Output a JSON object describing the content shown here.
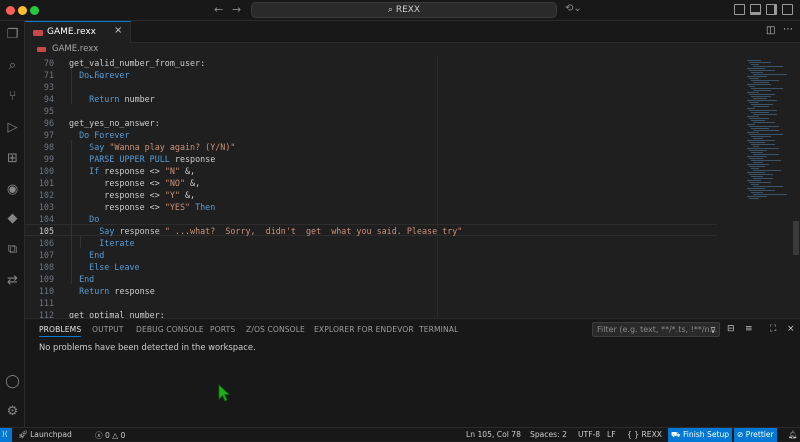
{
  "titlebar": {
    "search_label": "REXX"
  },
  "tab": {
    "label": "GAME.rexx",
    "close": "×"
  },
  "breadcrumb": {
    "file": "GAME.rexx"
  },
  "editor": {
    "lines": [
      {
        "n": "70",
        "t": "get_valid_number_from_user:"
      },
      {
        "n": "71",
        "t": "  Do Forever"
      },
      {
        "n": "93",
        "t": ""
      },
      {
        "n": "94",
        "t": "    Return number"
      },
      {
        "n": "95",
        "t": ""
      },
      {
        "n": "96",
        "t": "get_yes_no_answer:"
      },
      {
        "n": "97",
        "t": "  Do Forever"
      },
      {
        "n": "98",
        "t": "    Say \"Wanna play again? (Y/N)\""
      },
      {
        "n": "99",
        "t": "    PARSE UPPER PULL response"
      },
      {
        "n": "100",
        "t": "    If response <> \"N\" &,"
      },
      {
        "n": "101",
        "t": "       response <> \"NO\" &,"
      },
      {
        "n": "102",
        "t": "       response <> \"Y\" &,"
      },
      {
        "n": "103",
        "t": "       response <> \"YES\" Then"
      },
      {
        "n": "104",
        "t": "    Do"
      },
      {
        "n": "105",
        "t": "      Say response \" ...what?  Sorry,  didn't  get  what you said. Please try\""
      },
      {
        "n": "106",
        "t": "      Iterate"
      },
      {
        "n": "107",
        "t": "    End"
      },
      {
        "n": "108",
        "t": "    Else Leave"
      },
      {
        "n": "109",
        "t": "  End"
      },
      {
        "n": "110",
        "t": "  Return response"
      },
      {
        "n": "111",
        "t": ""
      },
      {
        "n": "112",
        "t": "get_optimal_number:"
      }
    ],
    "partial_line": "    End"
  },
  "panel": {
    "tabs": [
      "PROBLEMS",
      "OUTPUT",
      "DEBUG CONSOLE",
      "PORTS",
      "Z/OS CONSOLE",
      "EXPLORER FOR ENDEVOR",
      "TERMINAL"
    ],
    "filter_placeholder": "Filter (e.g. text, **/*.ts, !**/n...",
    "message": "No problems have been detected in the workspace."
  },
  "statusbar": {
    "launchpad": "Launchpad",
    "errors": "0",
    "warnings": "0",
    "position": "Ln 105, Col 78",
    "spaces": "Spaces: 2",
    "encoding": "UTF-8",
    "eol": "LF",
    "language": "REXX",
    "finish_setup": "Finish Setup",
    "prettier": "Prettier"
  },
  "colors": {
    "accent": "#0078d4",
    "keyword": "#569cd6",
    "string": "#ce9178",
    "text": "#cccccc",
    "label_color": "#dcdcaa"
  }
}
